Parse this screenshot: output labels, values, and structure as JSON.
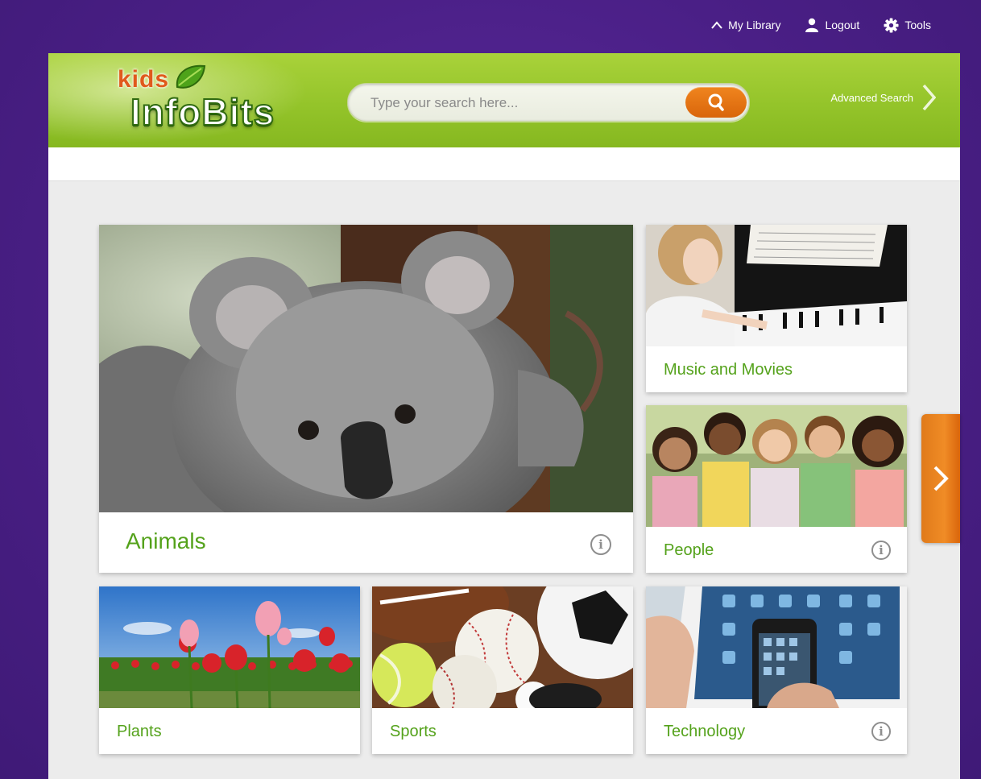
{
  "topnav": {
    "my_library": "My Library",
    "logout": "Logout",
    "tools": "Tools"
  },
  "logo": {
    "kids": "kids",
    "name": "InfoBits"
  },
  "search": {
    "placeholder": "Type your search here...",
    "value": "",
    "advanced": "Advanced Search"
  },
  "tiles": [
    {
      "label": "Animals",
      "image": "koala-photo",
      "has_info": true
    },
    {
      "label": "Music and Movies",
      "image": "piano-photo",
      "has_info": false
    },
    {
      "label": "People",
      "image": "children-photo",
      "has_info": true
    },
    {
      "label": "Plants",
      "image": "tulips-photo",
      "has_info": false
    },
    {
      "label": "Sports",
      "image": "balls-photo",
      "has_info": false
    },
    {
      "label": "Technology",
      "image": "tablet-phone-photo",
      "has_info": true
    }
  ],
  "icons": {
    "my_library": "chevron-up-icon",
    "logout": "user-icon",
    "tools": "gear-icon",
    "search": "search-icon",
    "advanced": "chevron-right-icon",
    "info": "info-icon",
    "next": "chevron-right-icon"
  },
  "colors": {
    "background": "#4a1f86",
    "header_green": "#94c42a",
    "label_green": "#54a21b",
    "accent_orange": "#e5761a"
  }
}
